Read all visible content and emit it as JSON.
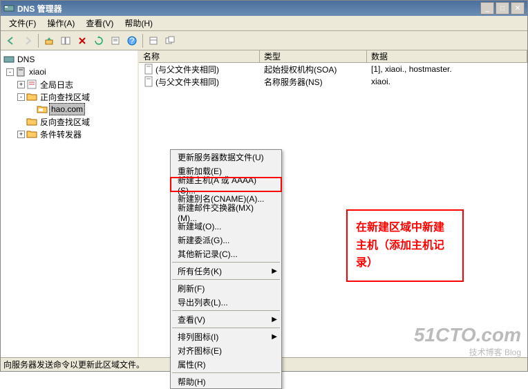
{
  "window": {
    "title": "DNS 管理器"
  },
  "menu": {
    "file": "文件(F)",
    "action": "操作(A)",
    "view": "查看(V)",
    "help": "帮助(H)"
  },
  "tree": {
    "root": "DNS",
    "server": "xiaoi",
    "global_log": "全局日志",
    "forward_zone": "正向查找区域",
    "hao_com": "hao.com",
    "reverse_zone": "反向查找区域",
    "conditional_forwarders": "条件转发器"
  },
  "list": {
    "col_name": "名称",
    "col_type": "类型",
    "col_data": "数据",
    "rows": [
      {
        "name": "(与父文件夹相同)",
        "type": "起始授权机构(SOA)",
        "data": "[1], xiaoi., hostmaster."
      },
      {
        "name": "(与父文件夹相同)",
        "type": "名称服务器(NS)",
        "data": "xiaoi."
      }
    ]
  },
  "context_menu": {
    "update_server": "更新服务器数据文件(U)",
    "reload": "重新加载(E)",
    "new_host": "新建主机(A 或 AAAA)(S)...",
    "new_alias": "新建别名(CNAME)(A)...",
    "new_mx": "新建邮件交换器(MX)(M)...",
    "new_domain": "新建域(O)...",
    "new_delegation": "新建委派(G)...",
    "other_new": "其他新记录(C)...",
    "all_tasks": "所有任务(K)",
    "refresh": "刷新(F)",
    "export_list": "导出列表(L)...",
    "view": "查看(V)",
    "arrange_icons": "排列图标(I)",
    "align_icons": "对齐图标(E)",
    "properties": "属性(R)",
    "help": "帮助(H)"
  },
  "annotation": "在新建区域中新建主机（添加主机记录）",
  "statusbar": "向服务器发送命令以更新此区域文件。",
  "watermark": {
    "big": "51CTO.com",
    "small": "技术博客  Blog"
  }
}
